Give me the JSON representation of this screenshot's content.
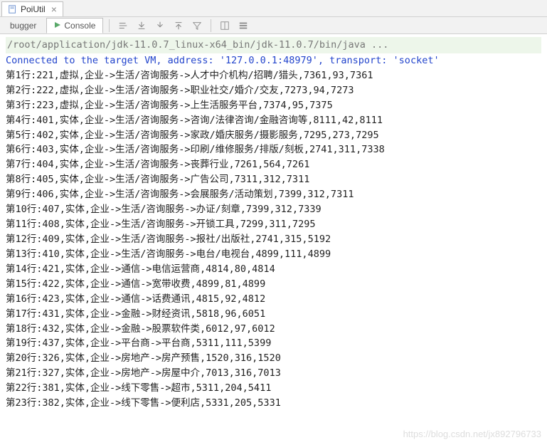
{
  "tab": {
    "title": "PoiUtil"
  },
  "subtabs": {
    "debugger": "bugger",
    "console": "Console"
  },
  "console": {
    "command": "/root/application/jdk-11.0.7_linux-x64_bin/jdk-11.0.7/bin/java ...",
    "connected": "Connected to the target VM, address: '127.0.0.1:48979', transport: 'socket'",
    "lines": [
      "第1行:221,虚拟,企业->生活/咨询服务->人才中介机构/招聘/猎头,7361,93,7361",
      "第2行:222,虚拟,企业->生活/咨询服务->职业社交/婚介/交友,7273,94,7273",
      "第3行:223,虚拟,企业->生活/咨询服务->上生活服务平台,7374,95,7375",
      "第4行:401,实体,企业->生活/咨询服务->咨询/法律咨询/金融咨询等,8111,42,8111",
      "第5行:402,实体,企业->生活/咨询服务->家政/婚庆服务/摄影服务,7295,273,7295",
      "第6行:403,实体,企业->生活/咨询服务->印刷/维修服务/排版/刻板,2741,311,7338",
      "第7行:404,实体,企业->生活/咨询服务->丧葬行业,7261,564,7261",
      "第8行:405,实体,企业->生活/咨询服务->广告公司,7311,312,7311",
      "第9行:406,实体,企业->生活/咨询服务->会展服务/活动策划,7399,312,7311",
      "第10行:407,实体,企业->生活/咨询服务->办证/刻章,7399,312,7339",
      "第11行:408,实体,企业->生活/咨询服务->开锁工具,7299,311,7295",
      "第12行:409,实体,企业->生活/咨询服务->报社/出版社,2741,315,5192",
      "第13行:410,实体,企业->生活/咨询服务->电台/电视台,4899,111,4899",
      "第14行:421,实体,企业->通信->电信运营商,4814,80,4814",
      "第15行:422,实体,企业->通信->宽带收费,4899,81,4899",
      "第16行:423,实体,企业->通信->话费通讯,4815,92,4812",
      "第17行:431,实体,企业->金融->财经资讯,5818,96,6051",
      "第18行:432,实体,企业->金融->股票软件类,6012,97,6012",
      "第19行:437,实体,企业->平台商->平台商,5311,111,5399",
      "第20行:326,实体,企业->房地产->房产预售,1520,316,1520",
      "第21行:327,实体,企业->房地产->房屋中介,7013,316,7013",
      "第22行:381,实体,企业->线下零售->超市,5311,204,5411",
      "第23行:382,实体,企业->线下零售->便利店,5331,205,5331"
    ]
  },
  "watermark": "https://blog.csdn.net/jx892796733"
}
